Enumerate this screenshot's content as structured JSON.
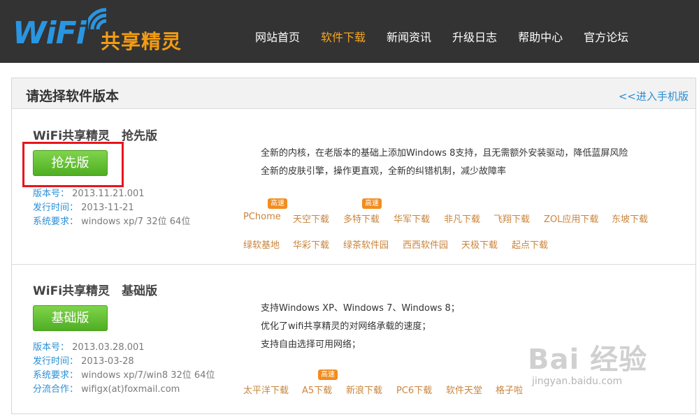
{
  "logo": {
    "wifi": "WiFi",
    "name": "共享精灵"
  },
  "nav": [
    {
      "label": "网站首页",
      "active": false
    },
    {
      "label": "软件下载",
      "active": true
    },
    {
      "label": "新闻资讯",
      "active": false
    },
    {
      "label": "升级日志",
      "active": false
    },
    {
      "label": "帮助中心",
      "active": false
    },
    {
      "label": "官方论坛",
      "active": false
    }
  ],
  "panel": {
    "title": "请选择软件版本",
    "mobile_link": "<<进入手机版"
  },
  "versions": [
    {
      "title": "WiFi共享精灵　抢先版",
      "button": "抢先版",
      "meta": [
        {
          "key": "版本号：",
          "value": "2013.11.21.001"
        },
        {
          "key": "发行时间：",
          "value": "2013-11-21"
        },
        {
          "key": "系统要求：",
          "value": "windows xp/7 32位 64位"
        }
      ],
      "desc": [
        "全新的内核，在老版本的基础上添加Windows 8支持，且无需额外安装驱动，降低蓝屏风险",
        "全新的皮肤引擎，操作更直观，全新的纠错机制，减少故障率"
      ],
      "mirrors": [
        "PChome",
        "天空下载",
        "多特下载",
        "华军下载",
        "非凡下载",
        "飞翔下载",
        "ZOL应用下载",
        "东坡下载",
        "绿软基地",
        "华彩下载",
        "绿茶软件园",
        "西西软件园",
        "天极下载",
        "起点下载"
      ],
      "badge": "高速"
    },
    {
      "title": "WiFi共享精灵　基础版",
      "button": "基础版",
      "meta": [
        {
          "key": "版本号：",
          "value": "2013.03.28.001"
        },
        {
          "key": "发行时间：",
          "value": "2013-03-28"
        },
        {
          "key": "系统要求：",
          "value": "windows xp/7/win8 32位 64位"
        },
        {
          "key": "分流合作：",
          "value": "wifigx(at)foxmail.com"
        }
      ],
      "desc": [
        "支持Windows XP、Windows 7、Windows 8；",
        "优化了wifi共享精灵的对网络承载的速度；",
        "支持自由选择可用网络；"
      ],
      "mirrors": [
        "太平洋下载",
        "A5下载",
        "新浪下载",
        "PC6下载",
        "软件天堂",
        "格子啦"
      ],
      "badge": "高速"
    }
  ],
  "watermark": {
    "text": "Bai 经验",
    "sub": "jingyan.baidu.com"
  },
  "colors": {
    "header_bg": "#333333",
    "nav_active": "#f6a623",
    "button_green": "#5cbf2a",
    "link_blue": "#2a8fd6",
    "mirror_orange": "#c9843c",
    "highlight_red": "#e8141b"
  }
}
